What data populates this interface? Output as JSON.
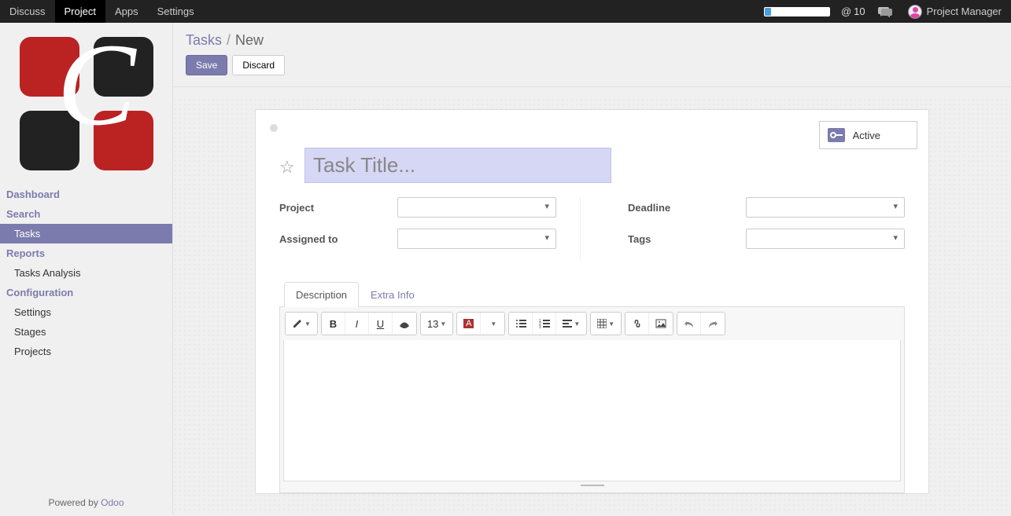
{
  "navbar": {
    "items": [
      "Discuss",
      "Project",
      "Apps",
      "Settings"
    ],
    "active_index": 1,
    "mention_count": "10",
    "user_name": "Project Manager"
  },
  "sidebar": {
    "groups": [
      {
        "type": "hdr",
        "label": "Dashboard"
      },
      {
        "type": "hdr",
        "label": "Search"
      },
      {
        "type": "item",
        "label": "Tasks",
        "active": true
      },
      {
        "type": "hdr",
        "label": "Reports"
      },
      {
        "type": "item",
        "label": "Tasks Analysis"
      },
      {
        "type": "hdr",
        "label": "Configuration"
      },
      {
        "type": "item",
        "label": "Settings"
      },
      {
        "type": "item",
        "label": "Stages"
      },
      {
        "type": "item",
        "label": "Projects"
      }
    ],
    "footer_prefix": "Powered by ",
    "footer_link": "Odoo"
  },
  "breadcrumb": {
    "parent": "Tasks",
    "sep": "/",
    "current": "New"
  },
  "buttons": {
    "save": "Save",
    "discard": "Discard"
  },
  "status": {
    "label": "Active"
  },
  "title_placeholder": "Task Title...",
  "fields": {
    "left": [
      {
        "label": "Project"
      },
      {
        "label": "Assigned to"
      }
    ],
    "right": [
      {
        "label": "Deadline"
      },
      {
        "label": "Tags"
      }
    ]
  },
  "tabs": [
    {
      "label": "Description",
      "active": true
    },
    {
      "label": "Extra Info"
    }
  ],
  "editor": {
    "font_size": "13"
  }
}
